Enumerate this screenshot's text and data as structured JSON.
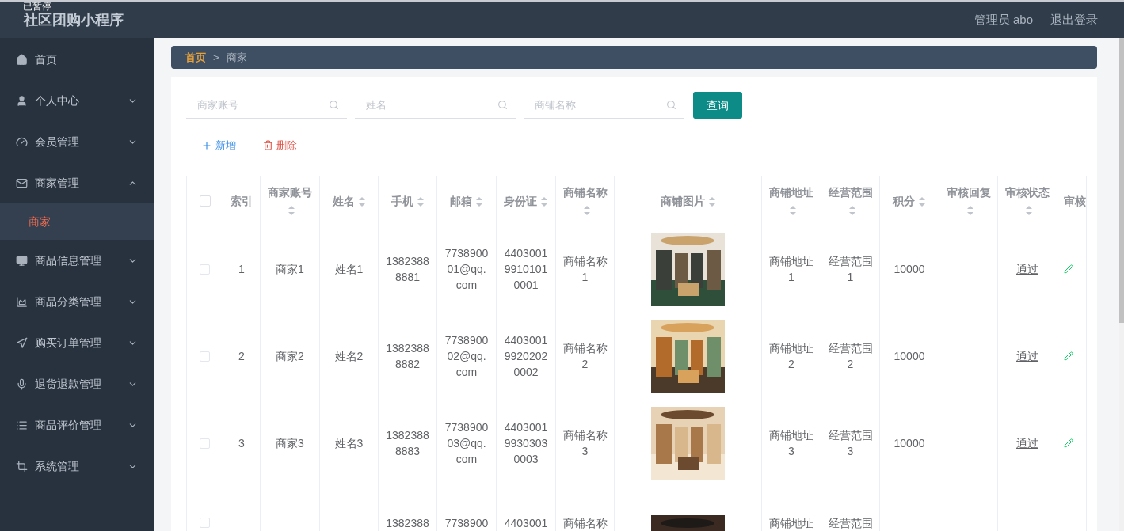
{
  "overlay_label": "已暂停",
  "app_title": "社区团购小程序",
  "user": {
    "name": "管理员 abo",
    "logout": "退出登录"
  },
  "sidebar": {
    "items": [
      {
        "label": "首页",
        "has_children": false
      },
      {
        "label": "个人中心",
        "has_children": true,
        "expanded": false
      },
      {
        "label": "会员管理",
        "has_children": true,
        "expanded": false
      },
      {
        "label": "商家管理",
        "has_children": true,
        "expanded": true,
        "children": [
          {
            "label": "商家",
            "selected": true
          }
        ]
      },
      {
        "label": "商品信息管理",
        "has_children": true,
        "expanded": false
      },
      {
        "label": "商品分类管理",
        "has_children": true,
        "expanded": false
      },
      {
        "label": "购买订单管理",
        "has_children": true,
        "expanded": false
      },
      {
        "label": "退货退款管理",
        "has_children": true,
        "expanded": false
      },
      {
        "label": "商品评价管理",
        "has_children": true,
        "expanded": false
      },
      {
        "label": "系统管理",
        "has_children": true,
        "expanded": false
      }
    ]
  },
  "breadcrumb": [
    "首页",
    "商家"
  ],
  "breadcrumb_separator": ">",
  "search": {
    "fields": [
      {
        "placeholder": "商家账号"
      },
      {
        "placeholder": "姓名"
      },
      {
        "placeholder": "商铺名称"
      }
    ],
    "button": "查询"
  },
  "actions": [
    {
      "kind": "add",
      "label": "新增"
    },
    {
      "kind": "delete",
      "label": "删除"
    }
  ],
  "table": {
    "header_checked": false,
    "columns": [
      {
        "label": "索引",
        "sortable": false
      },
      {
        "label": "商家账号",
        "sortable": true
      },
      {
        "label": "姓名",
        "sortable": true
      },
      {
        "label": "手机",
        "sortable": true
      },
      {
        "label": "邮箱",
        "sortable": true
      },
      {
        "label": "身份证",
        "sortable": true
      },
      {
        "label": "商铺名称",
        "sortable": true
      },
      {
        "label": "商铺图片",
        "sortable": true
      },
      {
        "label": "商铺地址",
        "sortable": true
      },
      {
        "label": "经营范围",
        "sortable": true
      },
      {
        "label": "积分",
        "sortable": true
      },
      {
        "label": "审核回复",
        "sortable": true
      },
      {
        "label": "审核状态",
        "sortable": true
      },
      {
        "label": "审核",
        "sortable": false
      }
    ],
    "rows": [
      {
        "kind": "full",
        "checked": false,
        "cells": [
          "1",
          "商家1",
          "姓名1",
          "13823888881",
          "773890001@qq.com",
          "440300199101010001",
          "商铺名称1",
          "",
          "商铺地址1",
          "经营范围1",
          "10000",
          "",
          "通过",
          ""
        ]
      },
      {
        "kind": "full",
        "checked": false,
        "cells": [
          "2",
          "商家2",
          "姓名2",
          "13823888882",
          "773890002@qq.com",
          "440300199202020002",
          "商铺名称2",
          "",
          "商铺地址2",
          "经营范围2",
          "10000",
          "",
          "通过",
          ""
        ]
      },
      {
        "kind": "full",
        "checked": false,
        "cells": [
          "3",
          "商家3",
          "姓名3",
          "13823888883",
          "773890003@qq.com",
          "440300199303030003",
          "商铺名称3",
          "",
          "商铺地址3",
          "经营范围3",
          "10000",
          "",
          "通过",
          ""
        ]
      },
      {
        "kind": "partial",
        "checked": false,
        "cells": [
          "",
          "",
          "",
          "1382388",
          "7738900",
          "4403001",
          "商铺名称",
          "",
          "商铺地址",
          "经营范围",
          "",
          "",
          "",
          ""
        ]
      }
    ]
  }
}
